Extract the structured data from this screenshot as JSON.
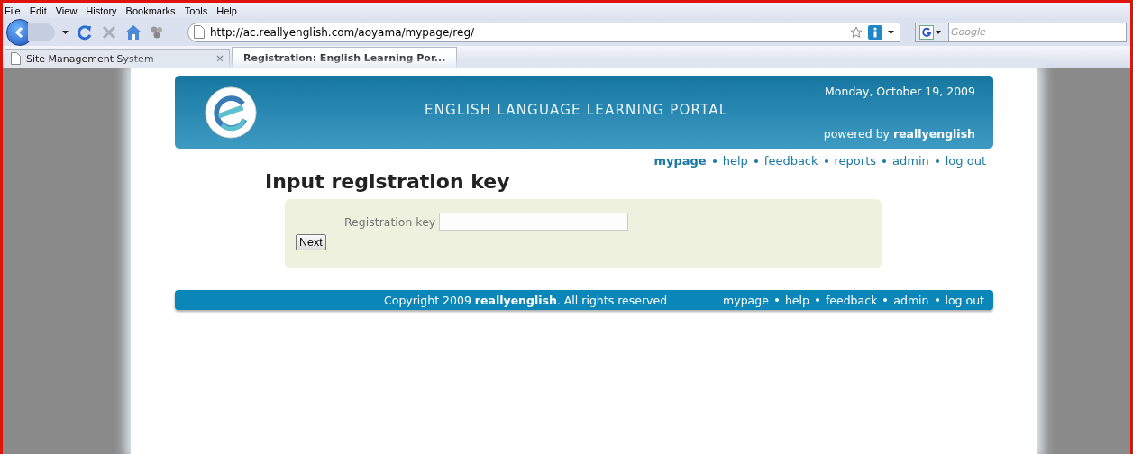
{
  "menu": [
    "File",
    "Edit",
    "View",
    "History",
    "Bookmarks",
    "Tools",
    "Help"
  ],
  "address": "http://ac.reallyenglish.com/aoyama/mypage/reg/",
  "search": {
    "placeholder": "Google"
  },
  "tabs": [
    {
      "label": "Site Management System",
      "selected": false
    },
    {
      "label": "Registration: English Learning Por...",
      "selected": true
    }
  ],
  "header": {
    "title": "ENGLISH LANGUAGE LEARNING PORTAL",
    "date": "Monday, October 19, 2009",
    "powered": "powered by **reallyenglish**"
  },
  "nav": [
    {
      "label": "mypage",
      "selected": true
    },
    {
      "label": "help",
      "selected": false
    },
    {
      "label": "feedback",
      "selected": false
    },
    {
      "label": "reports",
      "selected": false
    },
    {
      "label": "admin",
      "selected": false
    },
    {
      "label": "log out",
      "selected": false
    }
  ],
  "heading": "Input registration key",
  "form": {
    "label": "Registration key",
    "button": "Next"
  },
  "footer": {
    "copyright": "Copyright 2009 **reallyenglish**. All rights reserved",
    "links": [
      "mypage",
      "help",
      "feedback",
      "admin",
      "log out"
    ]
  }
}
